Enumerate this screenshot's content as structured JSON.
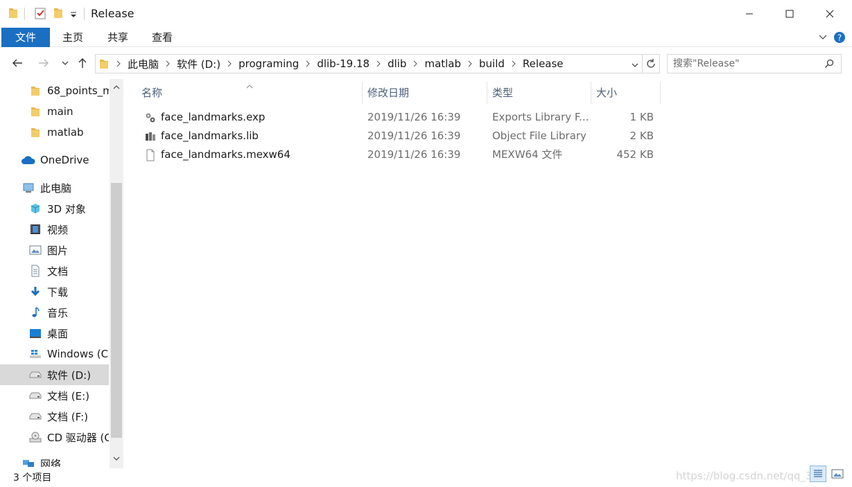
{
  "window": {
    "title": "Release"
  },
  "ribbon": {
    "tabs": [
      {
        "label": "文件"
      },
      {
        "label": "主页"
      },
      {
        "label": "共享"
      },
      {
        "label": "查看"
      }
    ]
  },
  "address": {
    "crumbs": [
      "此电脑",
      "软件 (D:)",
      "programing",
      "dlib-19.18",
      "dlib",
      "matlab",
      "build",
      "Release"
    ]
  },
  "search": {
    "placeholder": "搜索\"Release\""
  },
  "sidebar": {
    "items": [
      {
        "label": "68_points_m",
        "icon": "folder-icon"
      },
      {
        "label": "main",
        "icon": "folder-icon"
      },
      {
        "label": "matlab",
        "icon": "folder-icon"
      },
      {
        "label": "OneDrive",
        "icon": "cloud-icon"
      },
      {
        "label": "此电脑",
        "icon": "computer-icon"
      },
      {
        "label": "3D 对象",
        "icon": "cube-icon"
      },
      {
        "label": "视频",
        "icon": "film-icon"
      },
      {
        "label": "图片",
        "icon": "picture-icon"
      },
      {
        "label": "文档",
        "icon": "document-icon"
      },
      {
        "label": "下载",
        "icon": "download-icon"
      },
      {
        "label": "音乐",
        "icon": "music-icon"
      },
      {
        "label": "桌面",
        "icon": "desktop-icon"
      },
      {
        "label": "Windows (C:",
        "icon": "windows-drive-icon"
      },
      {
        "label": "软件 (D:)",
        "icon": "drive-icon",
        "selected": true
      },
      {
        "label": "文档 (E:)",
        "icon": "drive-icon"
      },
      {
        "label": "文档 (F:)",
        "icon": "drive-icon"
      },
      {
        "label": "CD 驱动器 (G",
        "icon": "cd-drive-icon"
      },
      {
        "label": "网络",
        "icon": "network-icon"
      }
    ]
  },
  "columns": {
    "name": "名称",
    "date": "修改日期",
    "type": "类型",
    "size": "大小"
  },
  "files": [
    {
      "name": "face_landmarks.exp",
      "date": "2019/11/26 16:39",
      "type": "Exports Library F...",
      "size": "1 KB",
      "icon": "exp-file-icon"
    },
    {
      "name": "face_landmarks.lib",
      "date": "2019/11/26 16:39",
      "type": "Object File Library",
      "size": "2 KB",
      "icon": "lib-file-icon"
    },
    {
      "name": "face_landmarks.mexw64",
      "date": "2019/11/26 16:39",
      "type": "MEXW64 文件",
      "size": "452 KB",
      "icon": "blank-file-icon"
    }
  ],
  "status": {
    "count": "3 个项目",
    "watermark": "https://blog.csdn.net/qq_39"
  },
  "colors": {
    "accent": "#1a6fc2",
    "folder": "#e8b84a",
    "selection": "#d9d9d9"
  }
}
